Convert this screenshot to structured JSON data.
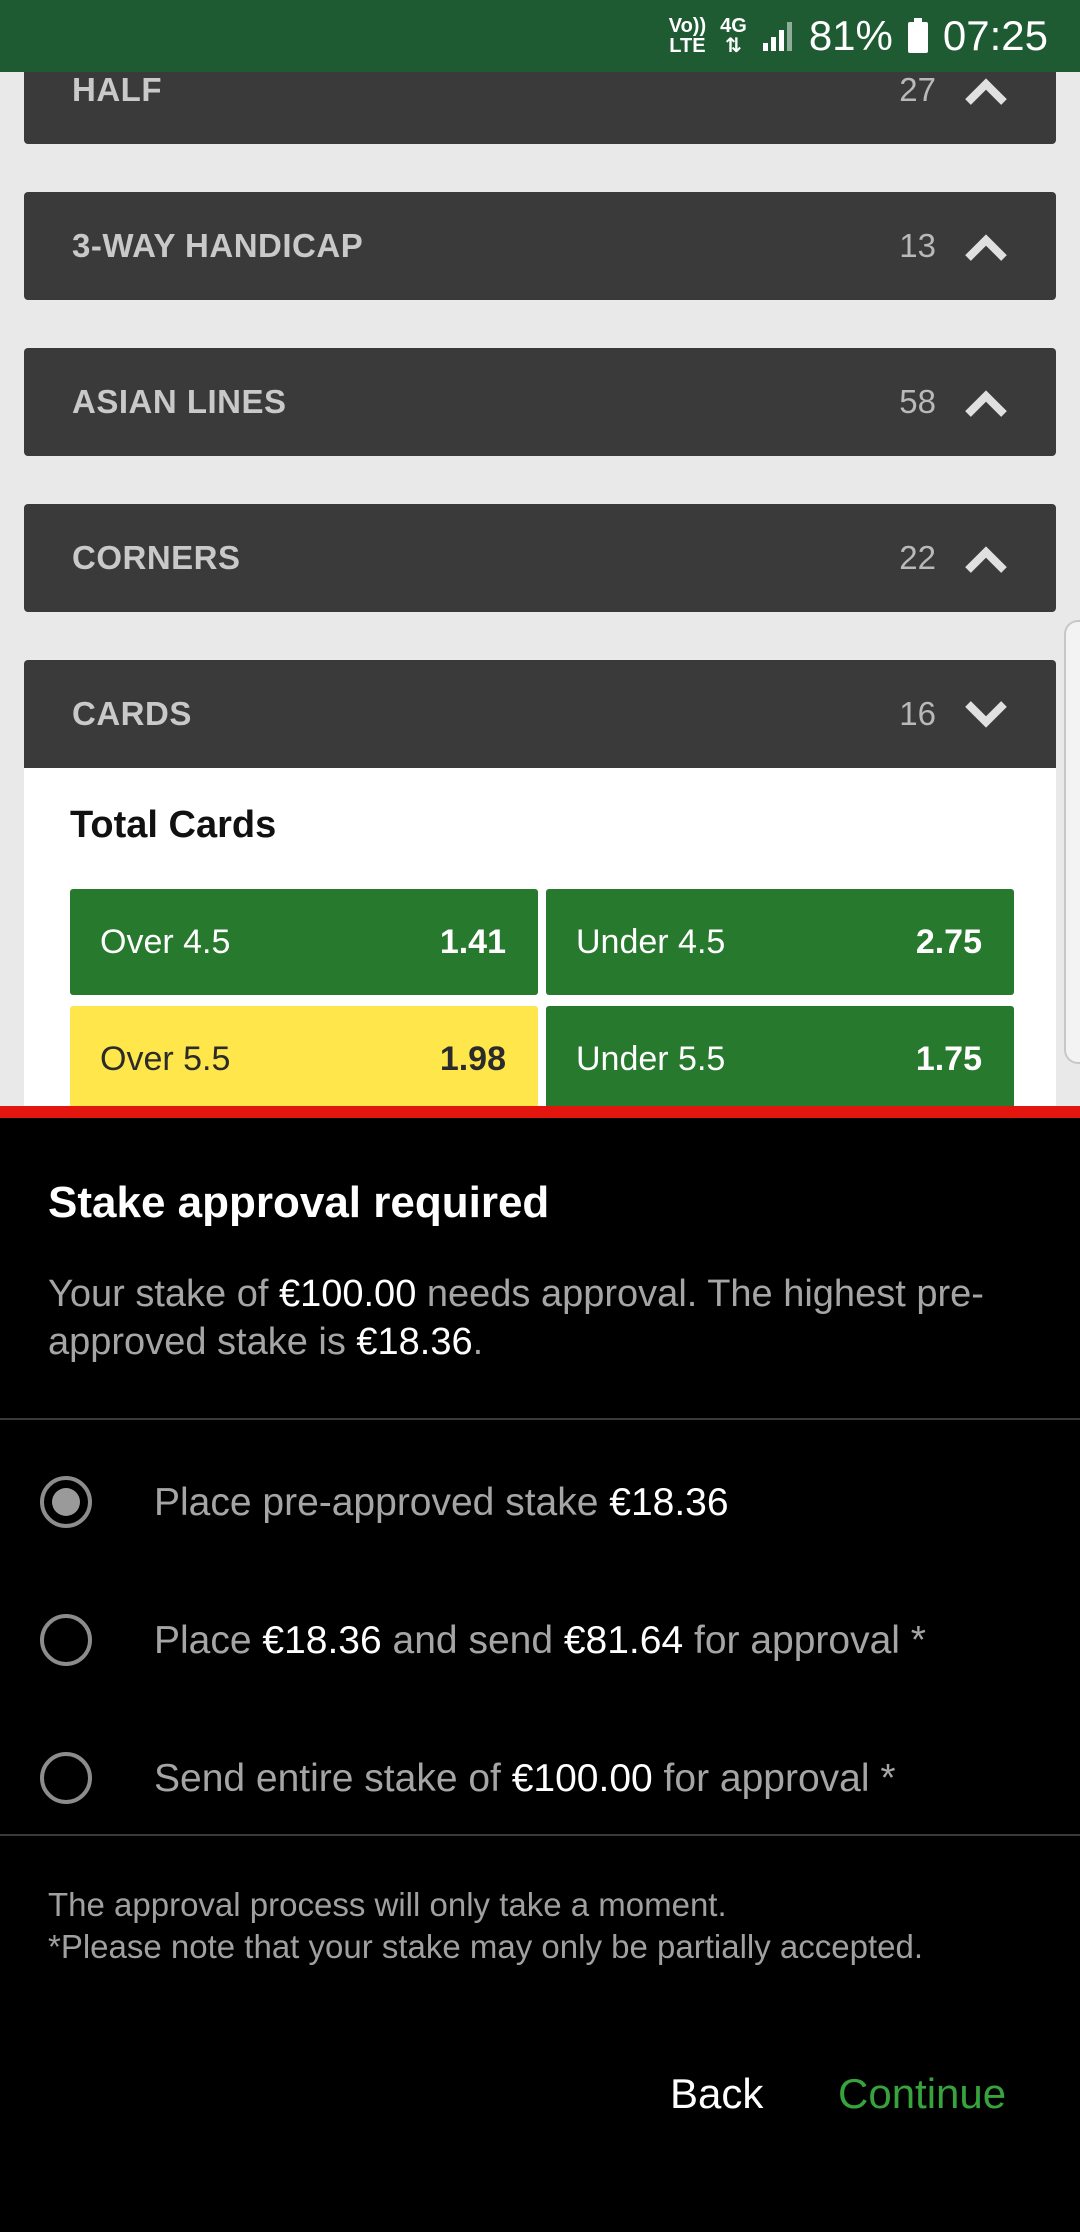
{
  "status_bar": {
    "network_top": "Vo))",
    "network_bottom": "LTE",
    "data_type": "4G",
    "battery_percent": "81%",
    "time": "07:25",
    "colors": {
      "background": "#1e5a32"
    }
  },
  "markets": [
    {
      "name": "HALF",
      "count": "27",
      "expanded": false
    },
    {
      "name": "3-WAY HANDICAP",
      "count": "13",
      "expanded": false
    },
    {
      "name": "ASIAN LINES",
      "count": "58",
      "expanded": false
    },
    {
      "name": "CORNERS",
      "count": "22",
      "expanded": false
    },
    {
      "name": "CARDS",
      "count": "16",
      "expanded": true
    }
  ],
  "cards_section": {
    "title": "Total Cards",
    "selections": [
      {
        "label": "Over 4.5",
        "odds": "1.41",
        "selected": false
      },
      {
        "label": "Under 4.5",
        "odds": "2.75",
        "selected": false
      },
      {
        "label": "Over 5.5",
        "odds": "1.98",
        "selected": true
      },
      {
        "label": "Under 5.5",
        "odds": "1.75",
        "selected": false
      }
    ]
  },
  "modal": {
    "title": "Stake approval required",
    "message": {
      "part1": "Your stake of ",
      "stake": "€100.00",
      "part2": " needs approval. The highest pre-approved stake is ",
      "max_stake": "€18.36",
      "part3": "."
    },
    "options": [
      {
        "pre": "Place pre-approved stake ",
        "amount1": "€18.36",
        "mid": "",
        "amount2": "",
        "post": "",
        "selected": true
      },
      {
        "pre": "Place ",
        "amount1": "€18.36",
        "mid": " and send ",
        "amount2": "€81.64",
        "post": " for approval *",
        "selected": false
      },
      {
        "pre": "Send entire stake of ",
        "amount1": "€100.00",
        "mid": "",
        "amount2": "",
        "post": " for approval *",
        "selected": false
      }
    ],
    "footnote_line1": "The approval process will only take a moment.",
    "footnote_line2": "*Please note that your stake may only be partially accepted.",
    "back_label": "Back",
    "continue_label": "Continue",
    "colors": {
      "accent_border": "#e3150f",
      "continue": "#37a33d",
      "odds_green": "#27792d",
      "odds_selected": "#ffe64a"
    }
  }
}
